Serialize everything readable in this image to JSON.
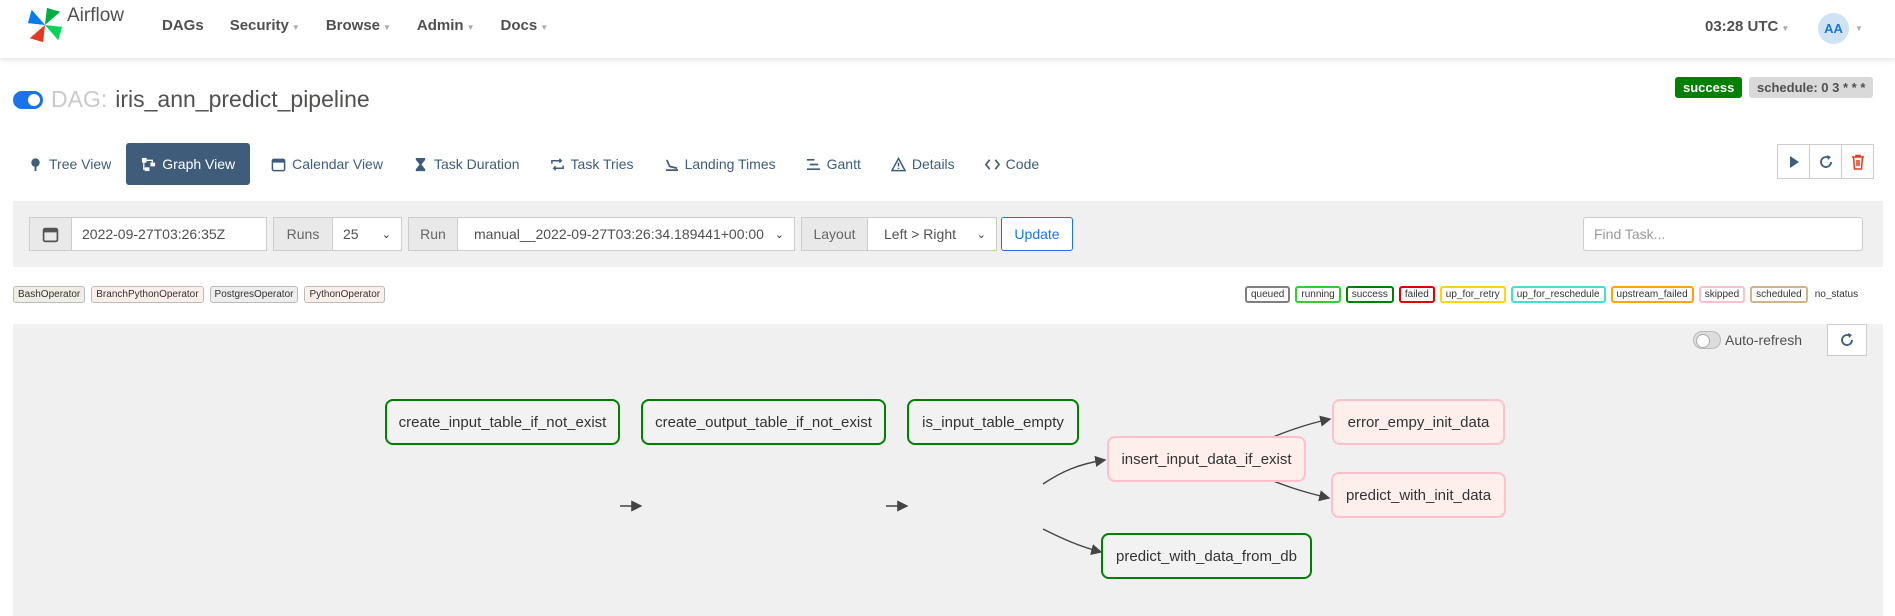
{
  "navbar": {
    "brand": "Airflow",
    "items": [
      {
        "label": "DAGs",
        "dropdown": false
      },
      {
        "label": "Security",
        "dropdown": true
      },
      {
        "label": "Browse",
        "dropdown": true
      },
      {
        "label": "Admin",
        "dropdown": true
      },
      {
        "label": "Docs",
        "dropdown": true
      }
    ],
    "time": "03:28 UTC",
    "avatar": "AA"
  },
  "dag": {
    "prefix": "DAG:",
    "name": "iris_ann_predict_pipeline",
    "status": "success",
    "schedule": "schedule: 0 3 * * *"
  },
  "tabs": [
    {
      "label": "Tree View",
      "icon": "tree-icon",
      "active": false
    },
    {
      "label": "Graph View",
      "icon": "graph-icon",
      "active": true
    },
    {
      "label": "Calendar View",
      "icon": "calendar-icon",
      "active": false
    },
    {
      "label": "Task Duration",
      "icon": "hourglass-icon",
      "active": false
    },
    {
      "label": "Task Tries",
      "icon": "repeat-icon",
      "active": false
    },
    {
      "label": "Landing Times",
      "icon": "landing-icon",
      "active": false
    },
    {
      "label": "Gantt",
      "icon": "gantt-icon",
      "active": false
    },
    {
      "label": "Details",
      "icon": "warning-icon",
      "active": false
    },
    {
      "label": "Code",
      "icon": "code-icon",
      "active": false
    }
  ],
  "filters": {
    "date": "2022-09-27T03:26:35Z",
    "runs_label": "Runs",
    "runs_value": "25",
    "run_label": "Run",
    "run_value": "manual__2022-09-27T03:26:34.189441+00:00",
    "layout_label": "Layout",
    "layout_value": "Left > Right",
    "update_label": "Update",
    "find_placeholder": "Find Task..."
  },
  "operators": [
    {
      "label": "BashOperator",
      "color": "#f0ede4"
    },
    {
      "label": "BranchPythonOperator",
      "color": "#ffefeb"
    },
    {
      "label": "PostgresOperator",
      "color": "#ededed"
    },
    {
      "label": "PythonOperator",
      "color": "#ffefeb"
    }
  ],
  "states": [
    {
      "label": "queued",
      "color": "#808080"
    },
    {
      "label": "running",
      "color": "#32cd32"
    },
    {
      "label": "success",
      "color": "#008000"
    },
    {
      "label": "failed",
      "color": "#e00000"
    },
    {
      "label": "up_for_retry",
      "color": "#ffd700"
    },
    {
      "label": "up_for_reschedule",
      "color": "#40e0d0"
    },
    {
      "label": "upstream_failed",
      "color": "#ffa500"
    },
    {
      "label": "skipped",
      "color": "#ffc0cb"
    },
    {
      "label": "scheduled",
      "color": "#d2b48c"
    },
    {
      "label": "no_status",
      "color": ""
    }
  ],
  "graph": {
    "auto_refresh_label": "Auto-refresh",
    "nodes": [
      {
        "label": "create_input_table_if_not_exist",
        "state": "success"
      },
      {
        "label": "create_output_table_if_not_exist",
        "state": "success"
      },
      {
        "label": "is_input_table_empty",
        "state": "success"
      },
      {
        "label": "insert_input_data_if_exist",
        "state": "skipped"
      },
      {
        "label": "predict_with_data_from_db",
        "state": "success"
      },
      {
        "label": "error_empy_init_data",
        "state": "skipped"
      },
      {
        "label": "predict_with_init_data",
        "state": "skipped"
      }
    ]
  },
  "colors": {
    "success": "#008000",
    "skipped": "#ffc0cb",
    "accent": "#1a73e8",
    "tab_active": "#3f5c7a"
  }
}
